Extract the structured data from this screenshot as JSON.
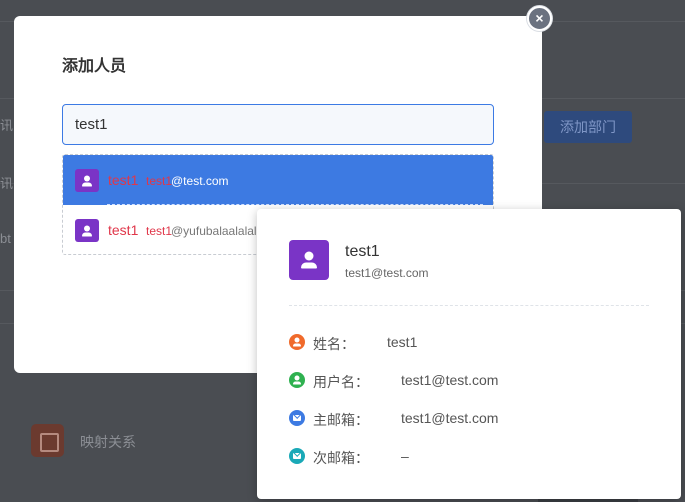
{
  "background": {
    "side_labels": [
      "讯",
      "讯",
      "bt"
    ],
    "add_department_button": "添加部门",
    "mapping_label": "映射关系"
  },
  "modal": {
    "title": "添加人员",
    "close_glyph": "×",
    "search": {
      "value": "test1",
      "placeholder": ""
    },
    "results": [
      {
        "name": "test1",
        "email_highlight": "test1",
        "email_rest": "@test.com"
      },
      {
        "name": "test1",
        "email_highlight": "test1",
        "email_rest": "@yufubalaalalal"
      }
    ]
  },
  "profile_card": {
    "name": "test1",
    "email": "test1@test.com",
    "fields": [
      {
        "label": "姓名：",
        "value": "test1",
        "icon": "person-icon",
        "color": "#f06a2b"
      },
      {
        "label": "用户名：",
        "value": "test1@test.com",
        "icon": "person-icon",
        "color": "#2fb150"
      },
      {
        "label": "主邮箱：",
        "value": "test1@test.com",
        "icon": "mail-icon",
        "color": "#3d7ae2"
      },
      {
        "label": "次邮箱：",
        "value": "–",
        "icon": "mail-icon",
        "color": "#1aa9b7"
      }
    ]
  },
  "colors": {
    "accent": "#3d7ae2",
    "avatar": "#7a34c6",
    "highlight_text": "#e0374a"
  }
}
